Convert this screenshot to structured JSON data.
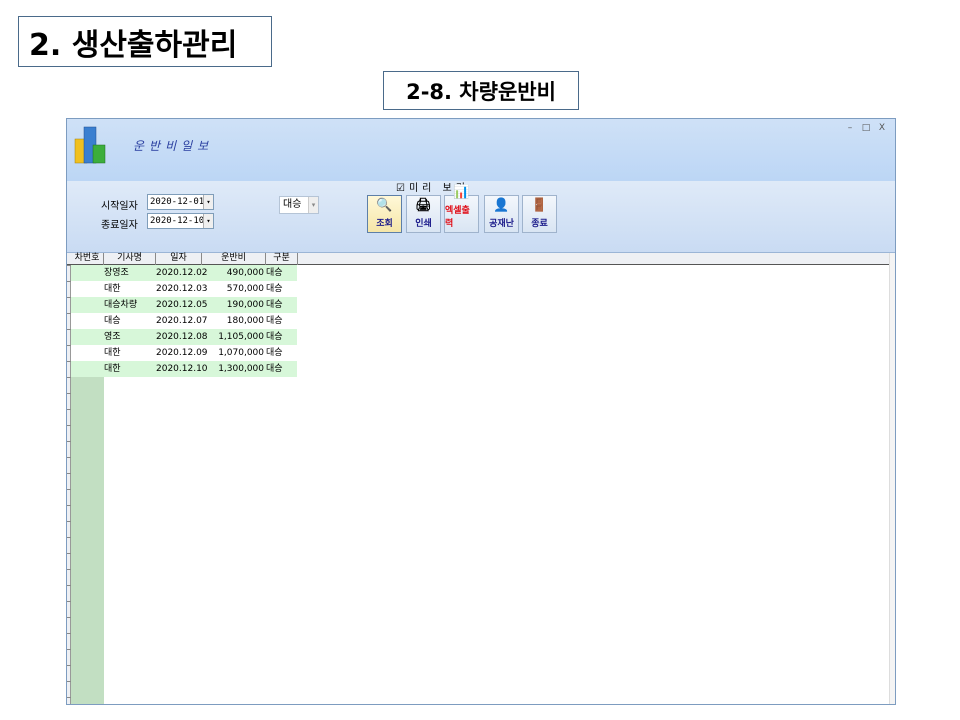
{
  "slide": {
    "title": "2. 생산출하관리",
    "subtitle": "2-8. 차량운반비"
  },
  "window": {
    "title": "운반비일보",
    "controls": [
      "–",
      "□",
      "X"
    ]
  },
  "filters": {
    "start_label": "시작일자",
    "start_value": "2020-12-01",
    "end_label": "종료일자",
    "end_value": "2020-12-10",
    "combo_value": "대승",
    "preview_label": "☑미리 보기"
  },
  "toolbar": {
    "buttons": [
      {
        "label": "조회",
        "icon": "🔍",
        "color": "#1a1a8a"
      },
      {
        "label": "인쇄",
        "icon": "🖨",
        "color": "#1a1a8a"
      },
      {
        "label": "엑셀출력",
        "icon": "📊",
        "color": "#e0101a"
      },
      {
        "label": "공재난",
        "icon": "👤",
        "color": "#1a1a8a"
      },
      {
        "label": "종료",
        "icon": "🚪",
        "color": "#1a1a8a"
      }
    ]
  },
  "grid": {
    "columns": [
      "차번호",
      "기사명",
      "일자",
      "운반비",
      "구분"
    ],
    "rows": [
      [
        "",
        "장영조",
        "2020.12.02",
        "490,000",
        "대승"
      ],
      [
        "",
        "대한",
        "2020.12.03",
        "570,000",
        "대승"
      ],
      [
        "",
        "대승차량",
        "2020.12.05",
        "190,000",
        "대승"
      ],
      [
        "",
        "대승",
        "2020.12.07",
        "180,000",
        "대승"
      ],
      [
        "",
        "영조",
        "2020.12.08",
        "1,105,000",
        "대승"
      ],
      [
        "",
        "대한",
        "2020.12.09",
        "1,070,000",
        "대승"
      ],
      [
        "",
        "대한",
        "2020.12.10",
        "1,300,000",
        "대승"
      ]
    ]
  },
  "colors": {
    "row_highlight": "#d7f7d9",
    "header_gradient": "#bcd6f5",
    "excel_label": "#e0101a"
  }
}
